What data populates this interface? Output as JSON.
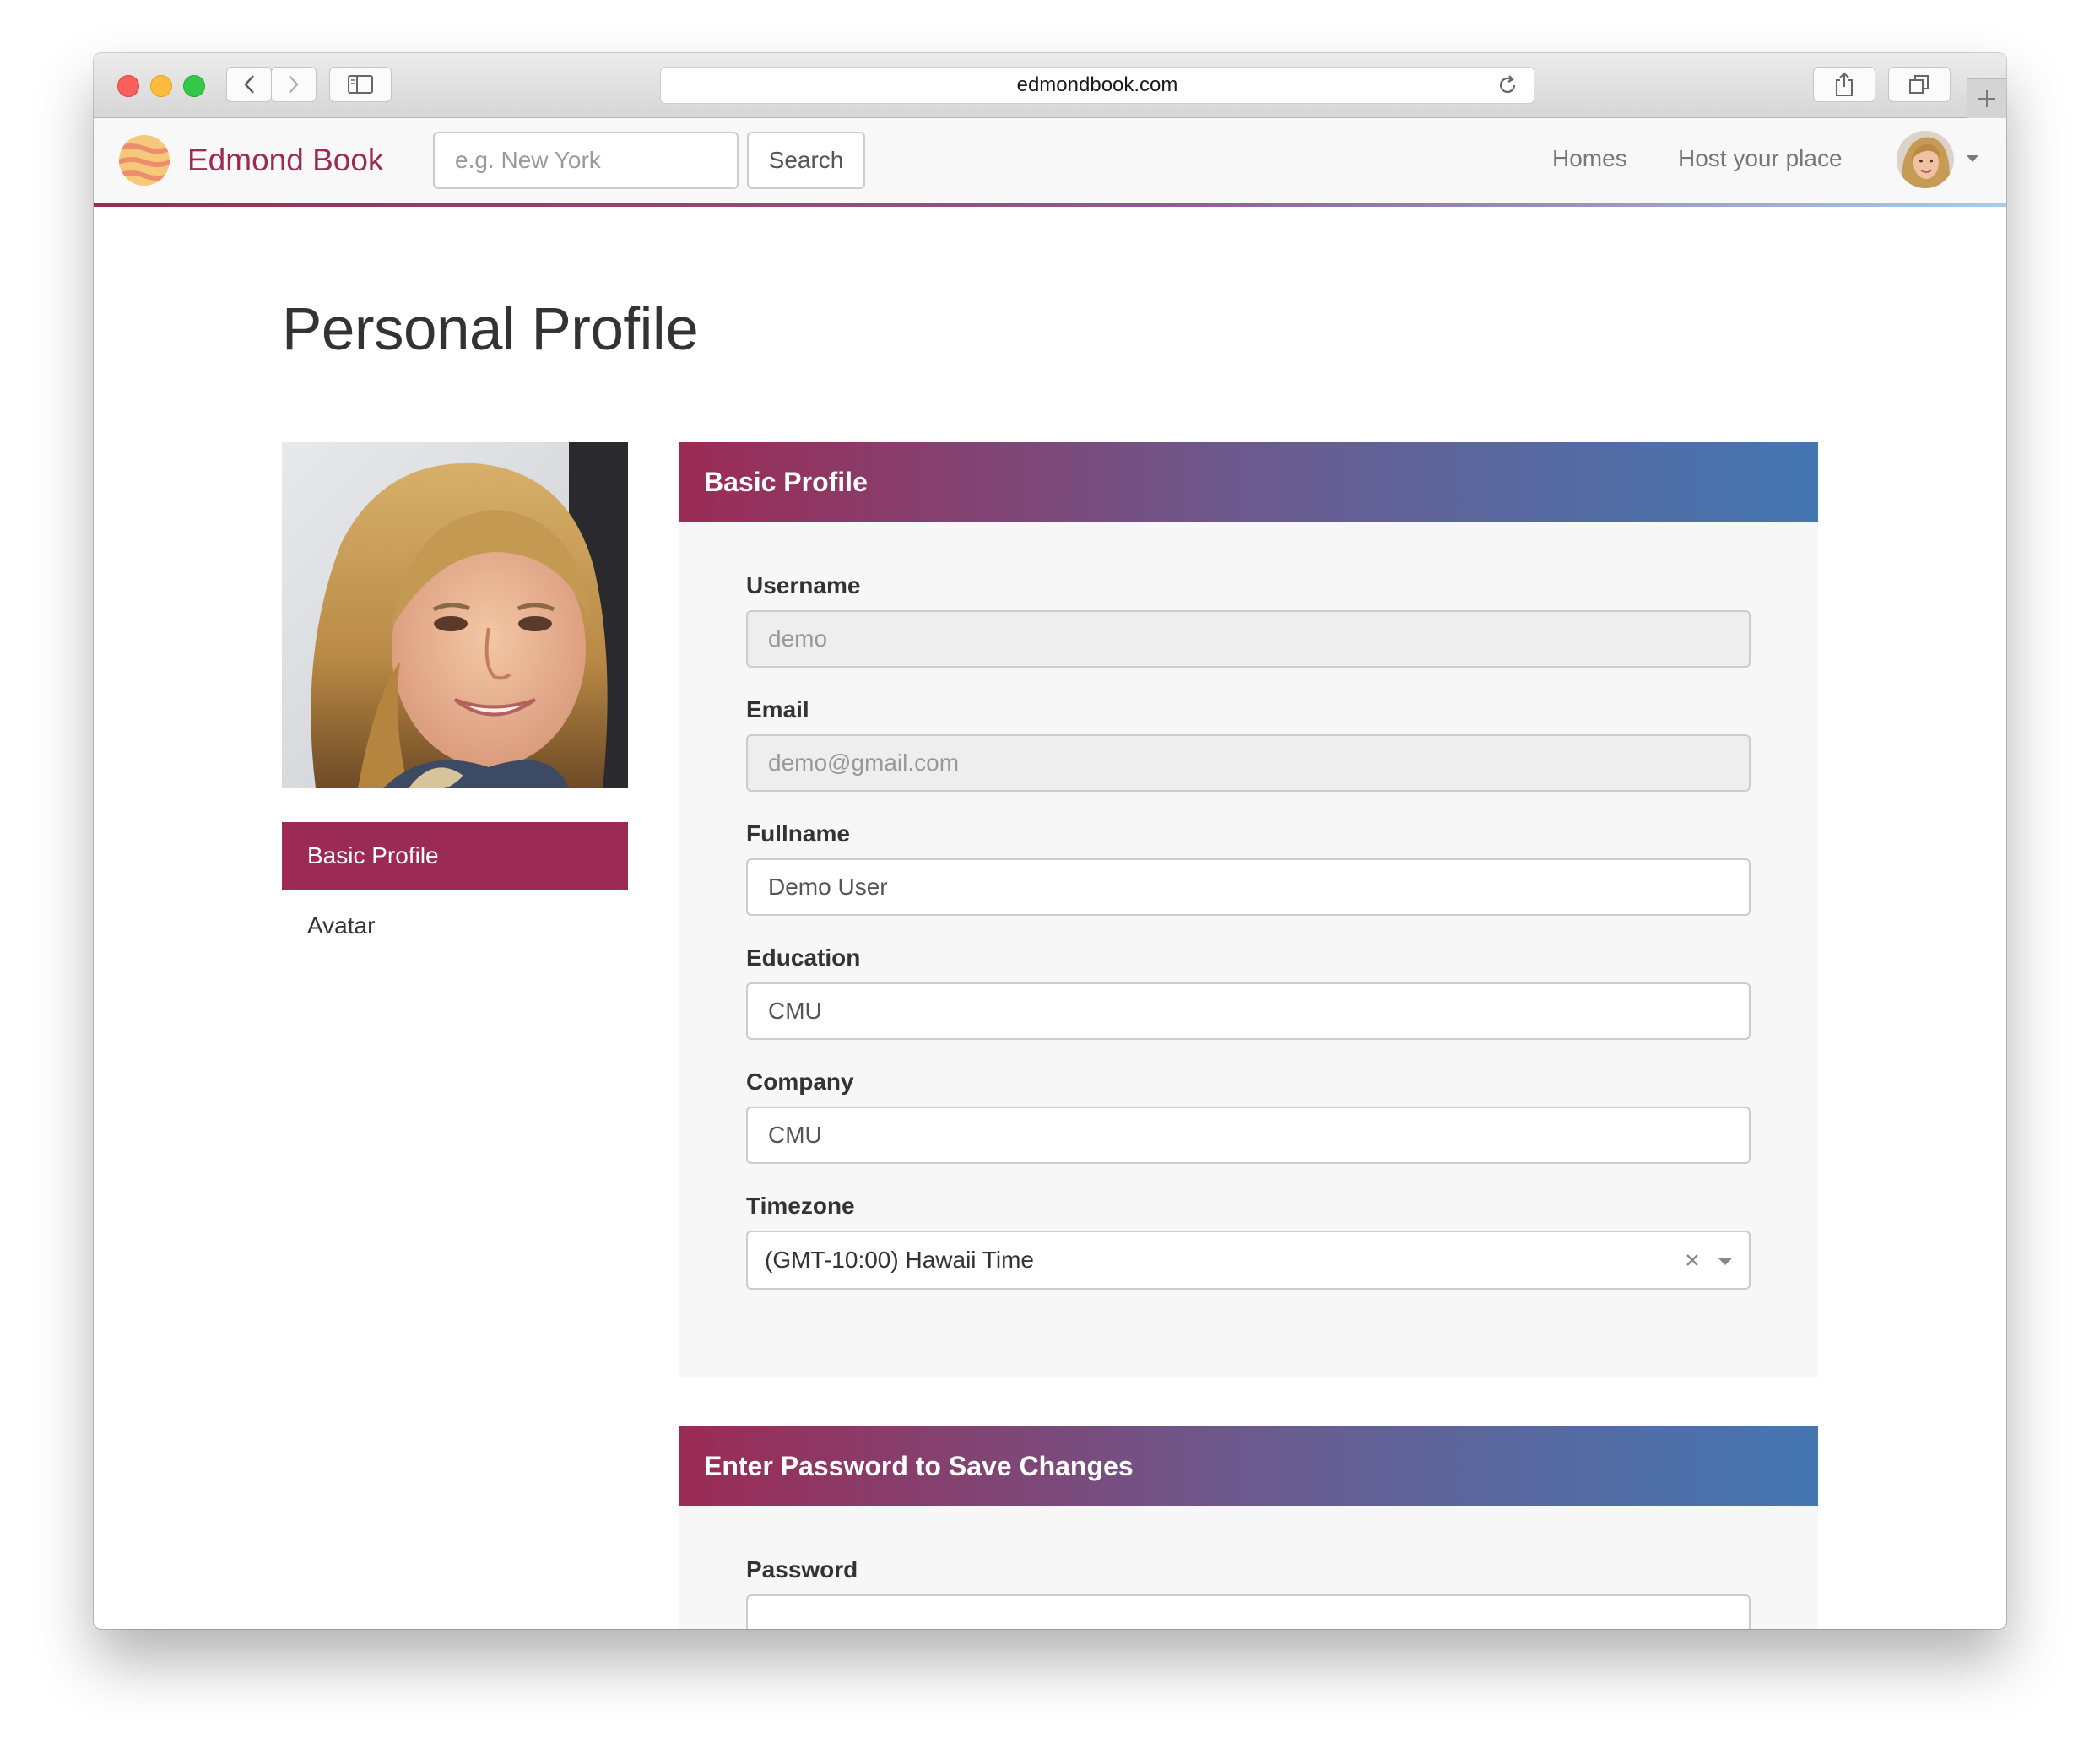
{
  "browser": {
    "url": "edmondbook.com"
  },
  "navbar": {
    "brand": "Edmond Book",
    "search_placeholder": "e.g. New York",
    "search_button": "Search",
    "links": [
      "Homes",
      "Host your place"
    ]
  },
  "page": {
    "title": "Personal Profile"
  },
  "sidebar": {
    "items": [
      {
        "label": "Basic Profile",
        "active": true
      },
      {
        "label": "Avatar",
        "active": false
      }
    ]
  },
  "basic_profile": {
    "heading": "Basic Profile",
    "fields": {
      "username": {
        "label": "Username",
        "value": "demo"
      },
      "email": {
        "label": "Email",
        "value": "demo@gmail.com"
      },
      "fullname": {
        "label": "Fullname",
        "value": "Demo User"
      },
      "education": {
        "label": "Education",
        "value": "CMU"
      },
      "company": {
        "label": "Company",
        "value": "CMU"
      },
      "timezone": {
        "label": "Timezone",
        "value": "(GMT-10:00) Hawaii Time"
      }
    }
  },
  "password_panel": {
    "heading": "Enter Password to Save Changes",
    "password_label": "Password"
  },
  "colors": {
    "brand": "#9b2b55",
    "gradient_end": "#4477b2"
  }
}
